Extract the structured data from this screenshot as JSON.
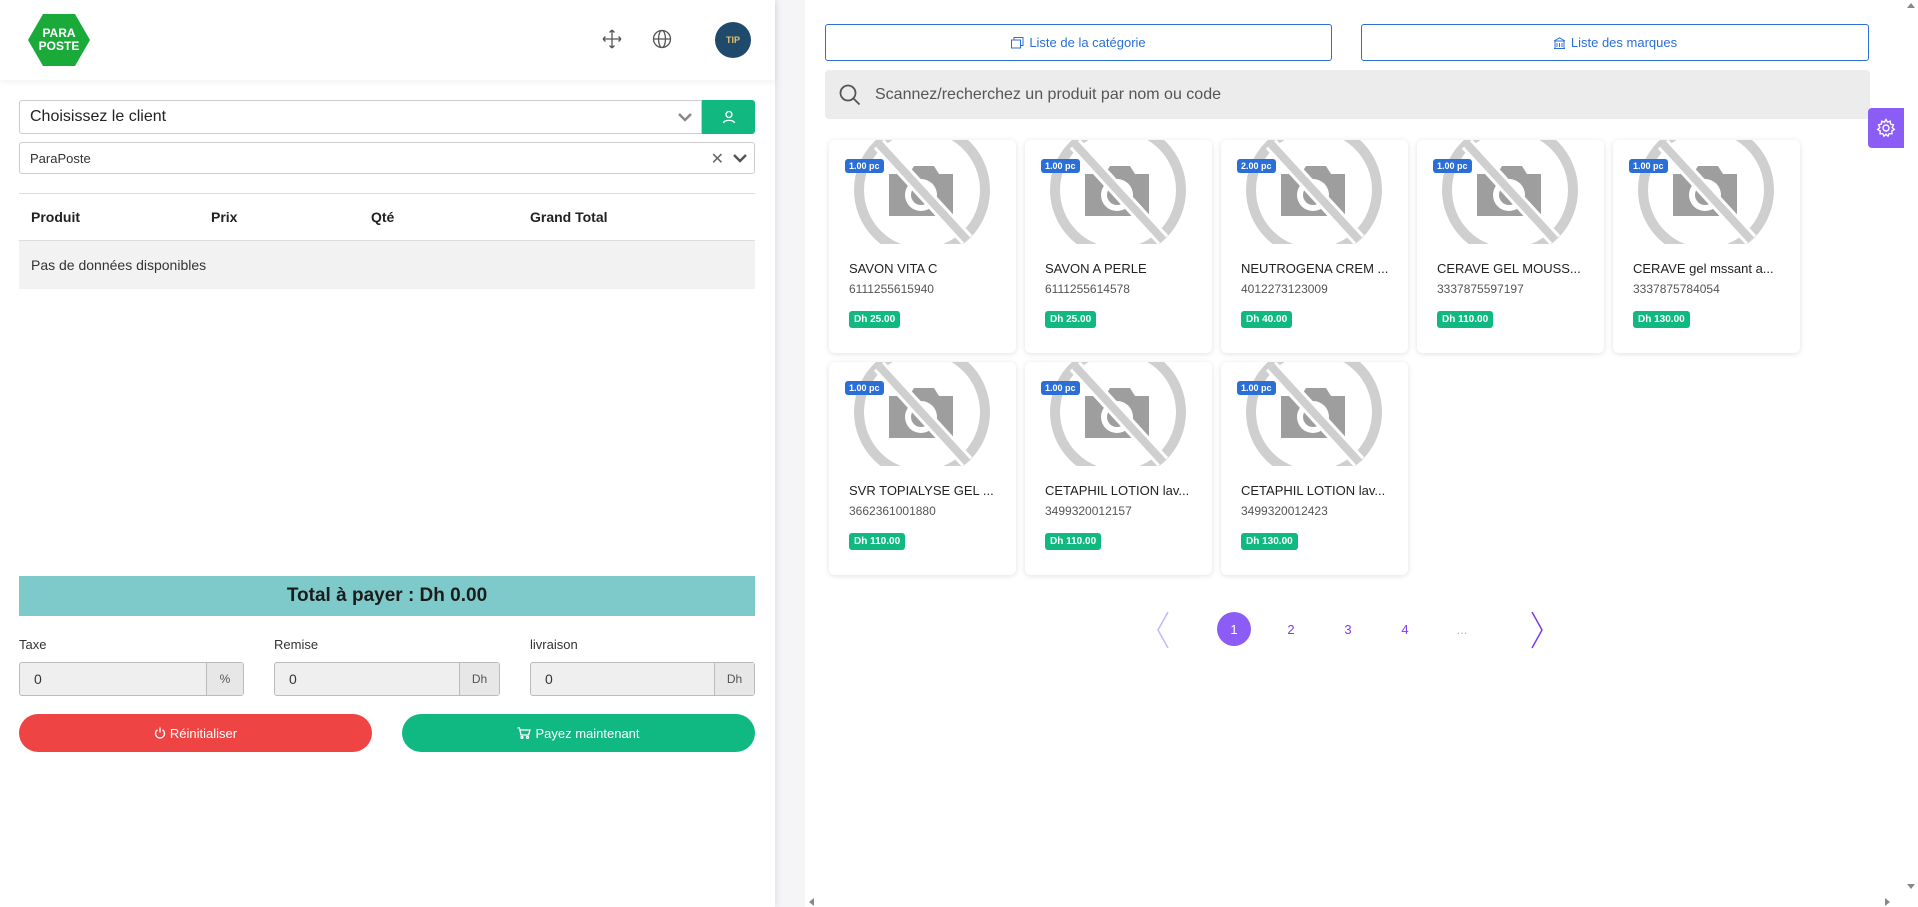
{
  "header": {
    "logo_text_line1": "PARA",
    "logo_text_line2": "POSTE",
    "avatar_text": "TIP"
  },
  "client": {
    "placeholder": "Choisissez le client",
    "store": "ParaPoste"
  },
  "table": {
    "columns": [
      "Produit",
      "Prix",
      "Qté",
      "Grand Total"
    ],
    "empty": "Pas de données disponibles"
  },
  "total": {
    "label": "Total à payer : Dh 0.00"
  },
  "fields": {
    "tax_label": "Taxe",
    "tax_value": "0",
    "tax_unit": "%",
    "discount_label": "Remise",
    "discount_value": "0",
    "discount_unit": "Dh",
    "shipping_label": "livraison",
    "shipping_value": "0",
    "shipping_unit": "Dh"
  },
  "actions": {
    "reset": "Réinitialiser",
    "pay": "Payez maintenant"
  },
  "catalog": {
    "category_button": "Liste de la catégorie",
    "brand_button": "Liste des marques",
    "search_placeholder": "Scannez/recherchez un produit par nom ou code"
  },
  "products": [
    {
      "qty": "1.00 pc",
      "name": "SAVON VITA C",
      "code": "6111255615940",
      "price": "Dh 25.00"
    },
    {
      "qty": "1.00 pc",
      "name": "SAVON A PERLE",
      "code": "6111255614578",
      "price": "Dh 25.00"
    },
    {
      "qty": "2.00 pc",
      "name": "NEUTROGENA CREM ...",
      "code": "4012273123009",
      "price": "Dh 40.00"
    },
    {
      "qty": "1.00 pc",
      "name": "CERAVE GEL MOUSS...",
      "code": "3337875597197",
      "price": "Dh 110.00"
    },
    {
      "qty": "1.00 pc",
      "name": "CERAVE gel mssant a...",
      "code": "3337875784054",
      "price": "Dh 130.00"
    },
    {
      "qty": "1.00 pc",
      "name": "SVR TOPIALYSE GEL ...",
      "code": "3662361001880",
      "price": "Dh 110.00"
    },
    {
      "qty": "1.00 pc",
      "name": "CETAPHIL LOTION lav...",
      "code": "3499320012157",
      "price": "Dh 110.00"
    },
    {
      "qty": "1.00 pc",
      "name": "CETAPHIL LOTION lav...",
      "code": "3499320012423",
      "price": "Dh 130.00"
    }
  ],
  "pagination": {
    "pages": [
      "1",
      "2",
      "3",
      "4",
      "..."
    ],
    "current": "1"
  },
  "colors": {
    "accent_green": "#10b981",
    "accent_red": "#ef4444",
    "accent_blue": "#2b6fd6",
    "accent_purple": "#8b5cf6",
    "total_bar": "#7ecaca"
  }
}
